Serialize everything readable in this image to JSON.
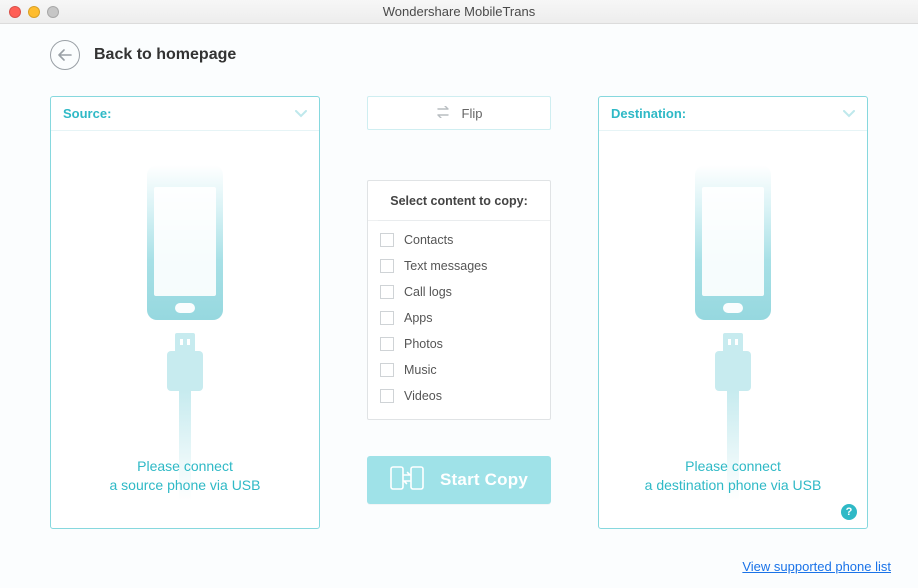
{
  "window": {
    "title": "Wondershare MobileTrans"
  },
  "nav": {
    "back_label": "Back to homepage"
  },
  "source": {
    "header": "Source:",
    "connect_line1": "Please connect",
    "connect_line2": "a source phone via USB"
  },
  "destination": {
    "header": "Destination:",
    "connect_line1": "Please connect",
    "connect_line2": "a destination phone via USB"
  },
  "middle": {
    "flip_label": "Flip",
    "select_header": "Select content to copy:",
    "items": [
      {
        "label": "Contacts"
      },
      {
        "label": "Text messages"
      },
      {
        "label": "Call logs"
      },
      {
        "label": "Apps"
      },
      {
        "label": "Photos"
      },
      {
        "label": "Music"
      },
      {
        "label": "Videos"
      }
    ],
    "start_label": "Start Copy"
  },
  "footer": {
    "supported_link": "View supported phone list"
  },
  "help": {
    "symbol": "?"
  }
}
